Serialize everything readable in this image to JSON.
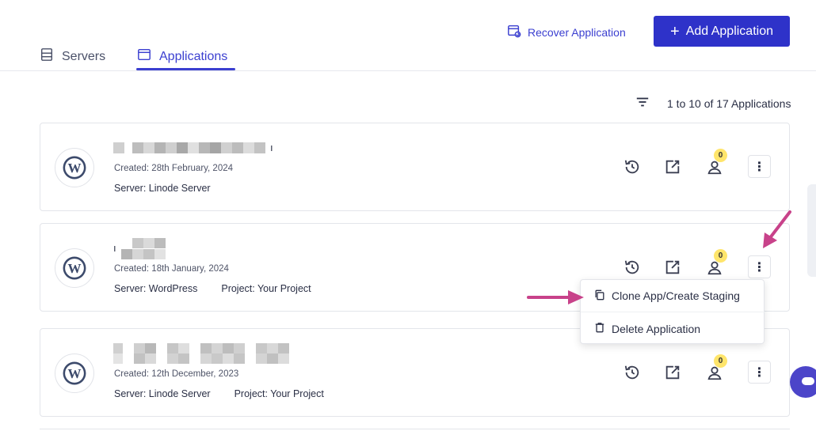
{
  "tabs": [
    {
      "label": "Servers",
      "icon": "server-icon"
    },
    {
      "label": "Applications",
      "icon": "window-icon",
      "active": true
    }
  ],
  "header": {
    "recover_label": "Recover Application",
    "add_label": "Add Application",
    "accent_color": "#2e32c9"
  },
  "pager": {
    "summary": "1 to 10 of 17 Applications"
  },
  "apps": [
    {
      "name_suffix": "ı",
      "created": "Created: 28th February, 2024",
      "server": "Server: Linode Server",
      "project": "",
      "collab_count": "0"
    },
    {
      "name_suffix": "ı",
      "created": "Created: 18th January, 2024",
      "server": "Server: WordPress",
      "project": "Project: Your Project",
      "collab_count": "0"
    },
    {
      "name_suffix": "",
      "created": "Created: 12th December, 2023",
      "server": "Server: Linode Server",
      "project": "Project: Your Project",
      "collab_count": "0"
    }
  ],
  "menu": {
    "clone_label": "Clone App/Create Staging",
    "delete_label": "Delete Application"
  }
}
